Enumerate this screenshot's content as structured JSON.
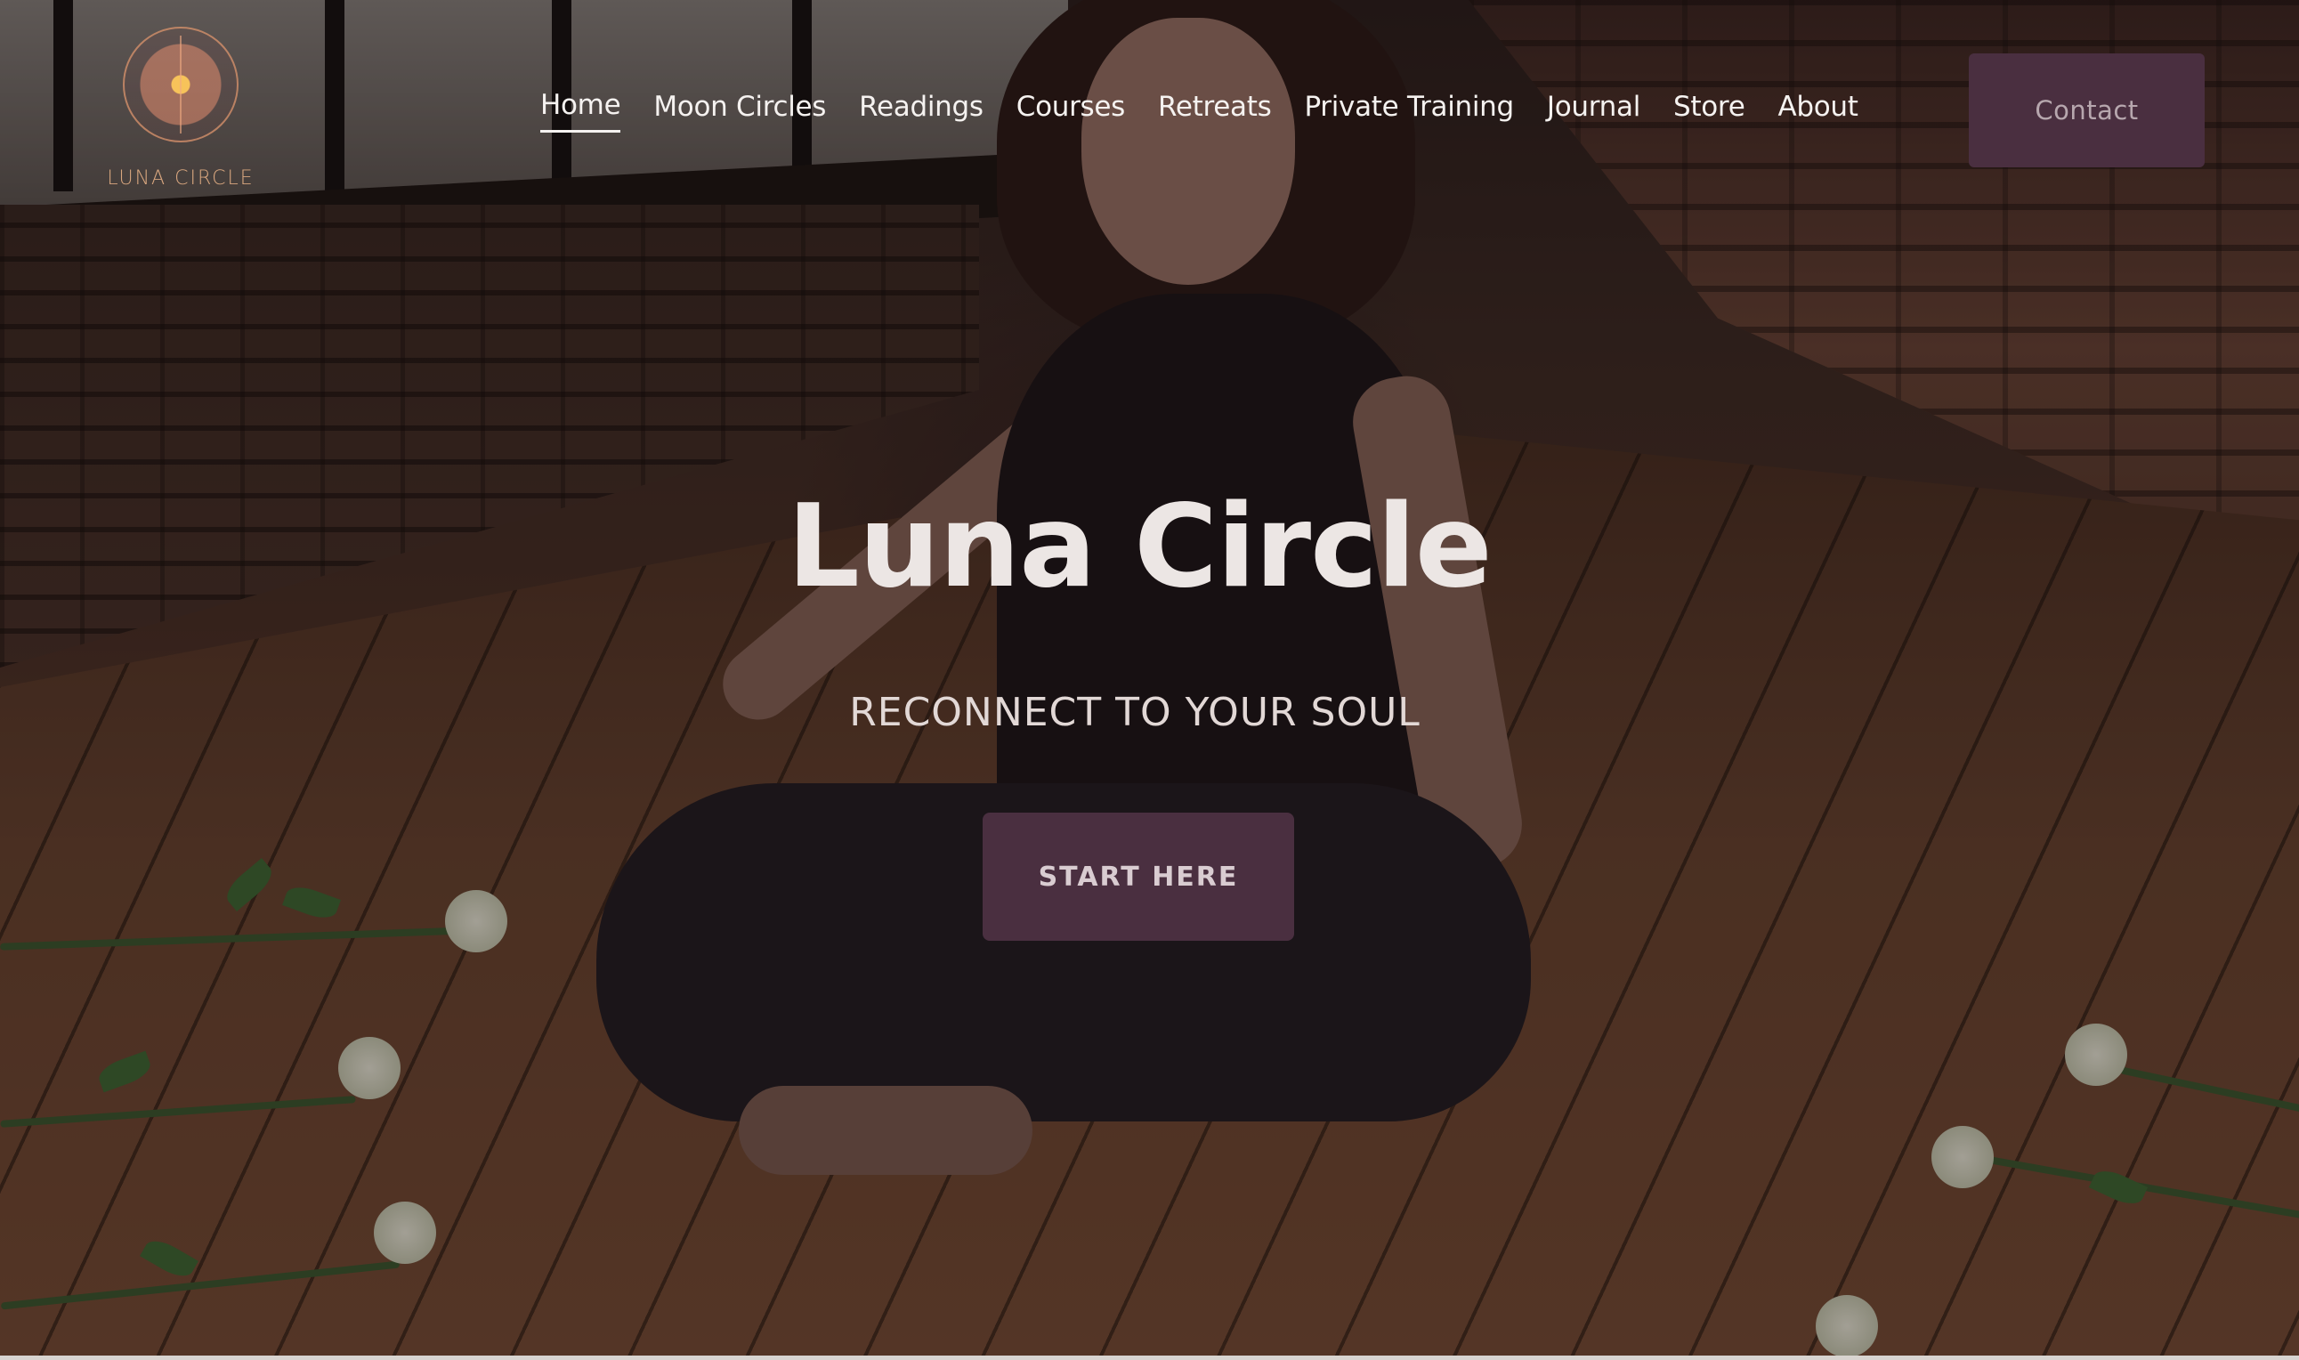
{
  "brand": {
    "wordmark": "LUNA CIRCLE"
  },
  "nav": {
    "items": [
      {
        "label": "Home",
        "active": true
      },
      {
        "label": "Moon Circles",
        "active": false
      },
      {
        "label": "Readings",
        "active": false
      },
      {
        "label": "Courses",
        "active": false
      },
      {
        "label": "Retreats",
        "active": false
      },
      {
        "label": "Private Training",
        "active": false
      },
      {
        "label": "Journal",
        "active": false
      },
      {
        "label": "Store",
        "active": false
      },
      {
        "label": "About",
        "active": false
      }
    ],
    "contact_label": "Contact"
  },
  "hero": {
    "title": "Luna Circle",
    "subtitle": "RECONNECT TO YOUR SOUL",
    "cta_label": "START HERE"
  },
  "colors": {
    "accent": "#4a2f40",
    "nav_text": "#f5f2f0",
    "logo": "#d9a77f"
  },
  "icons": {
    "logo_emblem": "sun-moon-emblem-icon"
  }
}
